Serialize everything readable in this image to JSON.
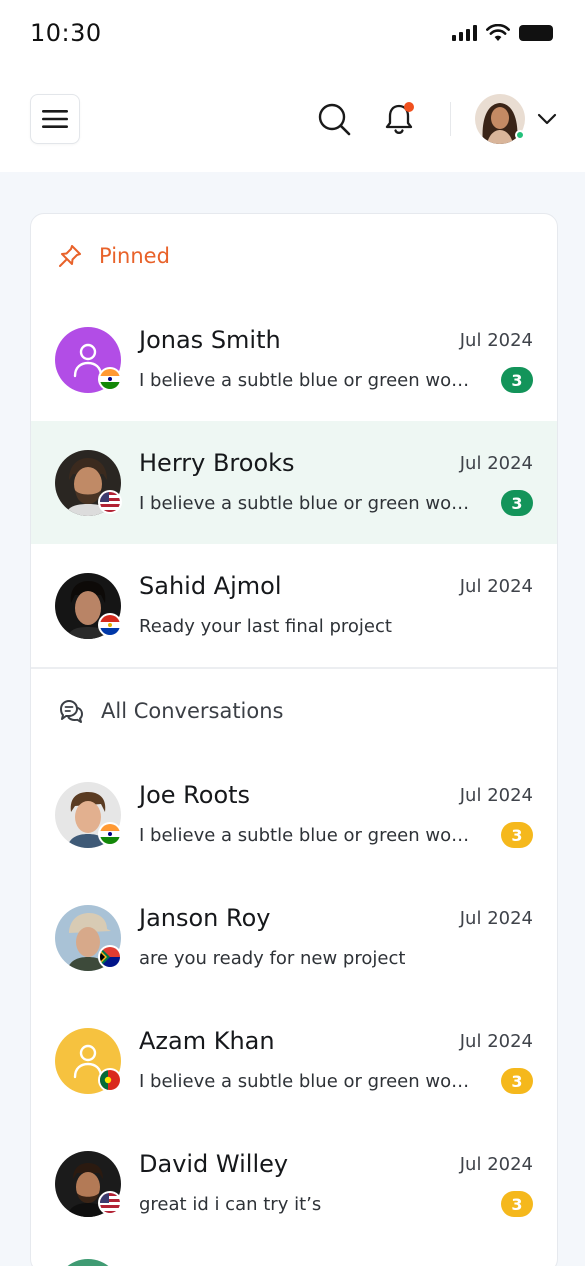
{
  "status_bar": {
    "time": "10:30"
  },
  "header": {
    "menu_icon": "hamburger-icon",
    "search_icon": "search-icon",
    "notification_icon": "bell-icon",
    "accent_color": "#f0501e"
  },
  "pinned": {
    "title": "Pinned",
    "icon": "pin-icon",
    "color": "#e8622a",
    "items": [
      {
        "name": "Jonas Smith",
        "date": "Jul 2024",
        "message": "I believe a subtle blue or green woul...",
        "badge": "3",
        "flag": "india"
      },
      {
        "name": "Herry Brooks",
        "date": "Jul 2024",
        "message": "I believe a subtle blue or green woul...",
        "badge": "3",
        "flag": "usa"
      },
      {
        "name": "Sahid Ajmol",
        "date": "Jul 2024",
        "message": "Ready your last final project",
        "badge": "",
        "flag": "paraguay"
      }
    ]
  },
  "all": {
    "title": "All Conversations",
    "icon": "chat-icon",
    "items": [
      {
        "name": "Joe Roots",
        "date": "Jul 2024",
        "message": "I believe a subtle blue or green woul...",
        "badge": "3",
        "flag": "india"
      },
      {
        "name": "Janson Roy",
        "date": "Jul 2024",
        "message": "are you ready for new project",
        "badge": "",
        "flag": "south-africa"
      },
      {
        "name": "Azam Khan",
        "date": "Jul 2024",
        "message": "I believe a subtle blue or green woul...",
        "badge": "3",
        "flag": "portugal"
      },
      {
        "name": "David Willey",
        "date": "Jul 2024",
        "message": "great id i can try it’s",
        "badge": "3",
        "flag": "usa"
      }
    ]
  },
  "colors": {
    "badge_green": "#13945a",
    "badge_yellow": "#f5b81c",
    "active_row": "#eef7f3",
    "online": "#22c07a"
  }
}
